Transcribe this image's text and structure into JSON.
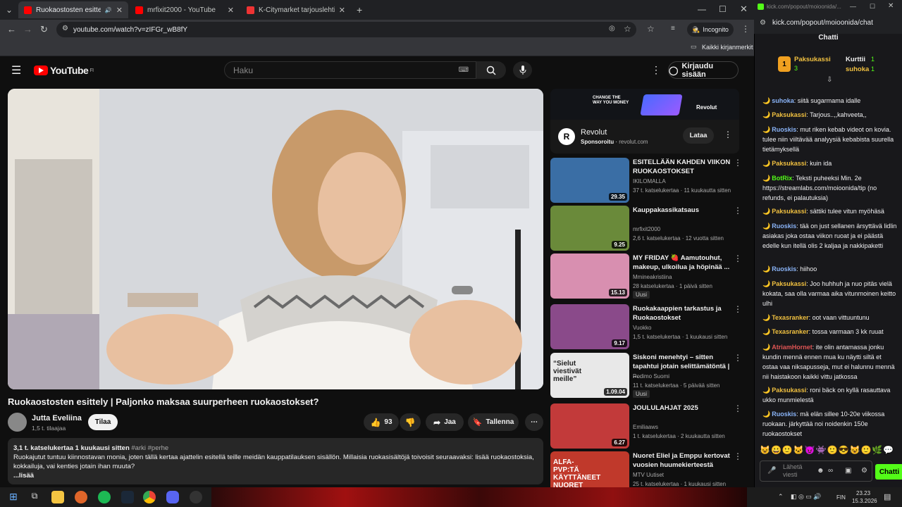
{
  "browser": {
    "tabs": [
      {
        "title": "Ruokaostosten esittely | Pa",
        "color": "#ff0000",
        "active": true
      },
      {
        "title": "mrfixit2000 - YouTube",
        "color": "#ff0000",
        "active": false
      },
      {
        "title": "K-Citymarket tarjouslehti",
        "color": "#e33",
        "active": false
      }
    ],
    "url": "youtube.com/watch?v=zIFGr_wB8fY",
    "incognito": "Incognito",
    "bookmarks_label": "Kaikki kirjanmerkit"
  },
  "youtube": {
    "logo": "YouTube",
    "logo_region": "FI",
    "search_placeholder": "Haku",
    "signin": "Kirjaudu sisään",
    "video_title": "Ruokaostosten esittely | Paljonko maksaa suurperheen ruokaostokset?",
    "channel": "Jutta Eveliina",
    "subscribers": "1,5 t. tilaajaa",
    "subscribe": "Tilaa",
    "likes": "93",
    "share": "Jaa",
    "save": "Tallenna",
    "desc_stats": "3,1 t. katselukertaa  1 kuukausi sitten",
    "desc_tags": "#arki #perhe",
    "desc_text": "Ruokajutut tuntuu kiinnostavan monia, joten tällä kertaa ajattelin esitellä teille meidän kauppatilauksen sisällön. Millaisia ruokasisältöjä toivoisit seuraavaksi: lisää ruokaostoksia, kokkailuja, vai kenties jotain ihan muuta?",
    "desc_more": "...lisää",
    "ad": {
      "banner_line1": "CHANGE THE",
      "banner_line2": "WAY YOU MONEY",
      "banner_brand": "Revolut",
      "name": "Revolut",
      "sponsored": "Sponsoroitu",
      "domain": "revolut.com",
      "cta": "Lataa"
    },
    "recommendations": [
      {
        "title": "ESITELLÄÄN KAHDEN VIIKON RUOKAOSTOKSET",
        "channel": "IKILOMALLA",
        "meta": "37 t. katselukertaa · 11 kuukautta sitten",
        "duration": "29.35",
        "badge": "",
        "thumb": "#3a6ea5"
      },
      {
        "title": "Kauppakassikatsaus",
        "channel": "mrfixit2000",
        "meta": "2,6 t. katselukertaa · 12 vuotta sitten",
        "duration": "9.25",
        "badge": "",
        "thumb": "#6a8a3a"
      },
      {
        "title": "MY FRIDAY 🍓 Aamutouhut, makeup, ulkoilua ja höpinää ...",
        "channel": "Mmineakristiina",
        "meta": "28 katselukertaa · 1 päivä sitten",
        "duration": "15.13",
        "badge": "Uusi",
        "thumb": "#d88fb0"
      },
      {
        "title": "Ruokakaappien tarkastus ja Ruokaostokset",
        "channel": "Vuokko",
        "meta": "1,5 t. katselukertaa · 1 kuukausi sitten",
        "duration": "9.17",
        "badge": "",
        "thumb": "#8a4a8a"
      },
      {
        "title": "Siskoni menehtyi – sitten tapahtui jotain selittämätöntä | ...",
        "channel": "Podimo Suomi",
        "meta": "11 t. katselukertaa · 5 päivää sitten",
        "duration": "1.09.04",
        "badge": "Uusi",
        "thumb": "#e8e8e8",
        "thumb_text": "“Sielut viestivät meille”"
      },
      {
        "title": "JOULULAHJAT 2025",
        "channel": "Emiliaaws",
        "meta": "1 t. katselukertaa · 2 kuukautta sitten",
        "duration": "6.27",
        "badge": "",
        "thumb": "#c23a3a"
      },
      {
        "title": "Nuoret Eliel ja Emppu kertovat vuosien huumekierteestä",
        "channel": "MTV Uutiset",
        "meta": "25 t. katselukertaa · 1 kuukausi sitten",
        "duration": "",
        "badge": "",
        "thumb": "#c0392b",
        "thumb_text": "ALFA-PVP:TÄ KÄYTTÄNEET NUORET KERTOVAT"
      }
    ]
  },
  "chat": {
    "url": "kick.com/popout/moioonida/...",
    "page_url": "kick.com/popout/moioonida/chat",
    "title": "Chatti",
    "leaders": [
      {
        "name": "Paksukassi",
        "count": "3"
      },
      {
        "name": "Kurttii",
        "count": "1"
      },
      {
        "name": "suhoka",
        "count": "1"
      }
    ],
    "messages": [
      {
        "user": "suhoka",
        "color": "#8ab4f8",
        "text": "siitä sugarmama idalle"
      },
      {
        "user": "Paksukassi",
        "color": "#f0c040",
        "text": "Tarjous..,,kahveeta,,"
      },
      {
        "user": "Ruoskis",
        "color": "#8ab4f8",
        "text": "mut riken kebab videot on kovia. tulee niin viiltävää analyysiä kebabista suurella tietämyksellä"
      },
      {
        "user": "Paksukassi",
        "color": "#f0c040",
        "text": "kuin ida"
      },
      {
        "user": "BotRix",
        "color": "#53fc18",
        "text": "Teksti puheeksi Min. 2e https://streamlabs.com/moioonida/tip (no refunds, ei palautuksia)"
      },
      {
        "user": "Paksukassi",
        "color": "#f0c040",
        "text": "sättiki tulee vitun myöhäsä"
      },
      {
        "user": "Ruoskis",
        "color": "#8ab4f8",
        "text": "tää on just sellanen ärsyttävä lidlin asiakas joka ostaa viikon ruoat ja ei päästä edelle kun itellä olis 2 kaljaa ja nakkipaketti"
      },
      {
        "user": "Ruoskis",
        "color": "#8ab4f8",
        "text": "hiihoo"
      },
      {
        "user": "Paksukassi",
        "color": "#f0c040",
        "text": "Joo huhhuh ja nuo pitäs vielä kokata, saa olla varmaa aika vitunmoinen keitto ulhi"
      },
      {
        "user": "Texasranker",
        "color": "#f0c040",
        "text": "oot vaan vittuuntunu"
      },
      {
        "user": "Texasranker",
        "color": "#f0c040",
        "text": "tossa varmaan 3 kk ruuat"
      },
      {
        "user": "AtriamHornet",
        "color": "#e05555",
        "text": "ite olin antamassa jonku kundin mennä ennen mua ku näytti siltä et ostaa vaa niksapusseja, mut ei halunnu mennä nii haistakoon kaikki vittu jatkossa"
      },
      {
        "user": "Paksukassi",
        "color": "#f0c040",
        "text": "roni bäck on kyllä rasauttava ukko munmielestä"
      },
      {
        "user": "Ruoskis",
        "color": "#8ab4f8",
        "text": "mä elän sillee 10-20e viikossa ruokaan. järkyttää noi noidenkin 150e ruokaostokset"
      }
    ],
    "input_placeholder": "Lähetä viesti",
    "send": "Chatti"
  },
  "taskbar": {
    "lang": "FIN",
    "time": "23.23",
    "date": "15.3.2026"
  }
}
